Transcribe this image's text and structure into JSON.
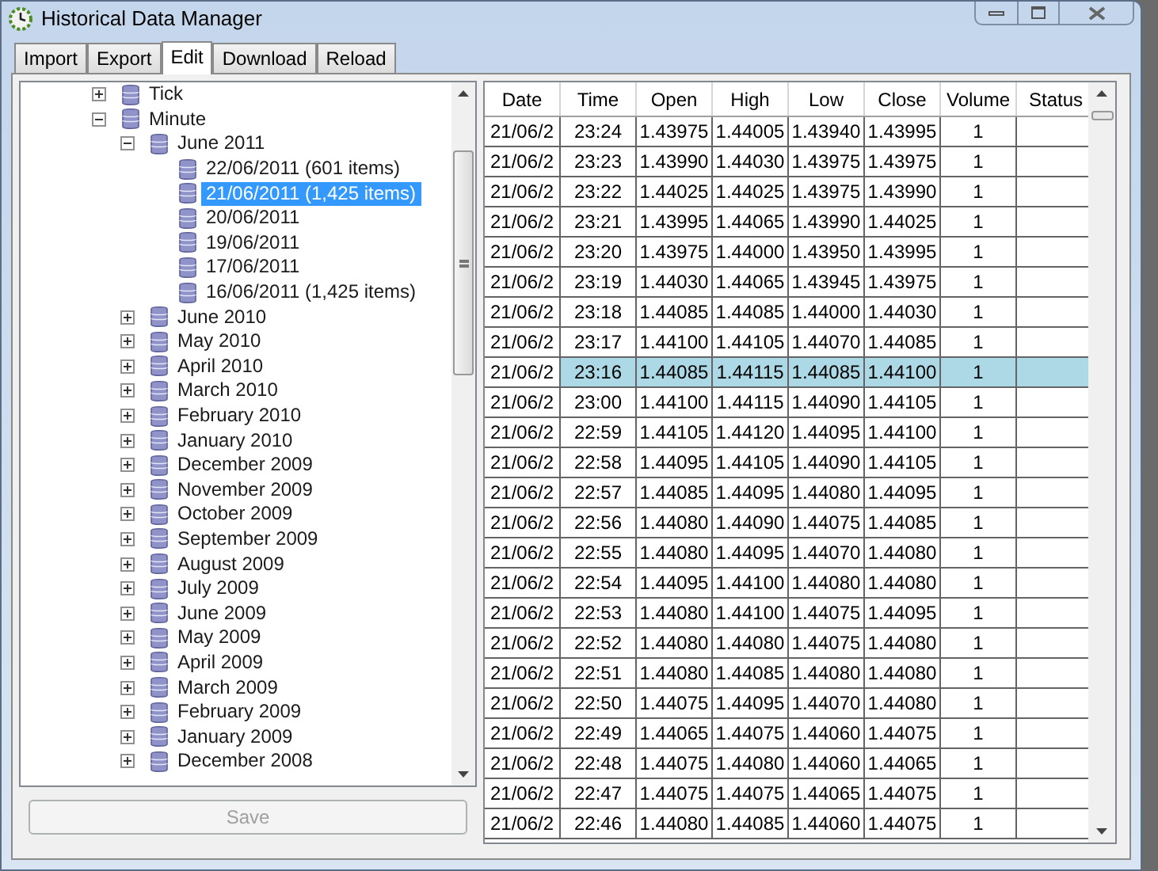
{
  "window": {
    "title": "Historical Data Manager"
  },
  "tabs": [
    {
      "label": "Import",
      "selected": false
    },
    {
      "label": "Export",
      "selected": false
    },
    {
      "label": "Edit",
      "selected": true
    },
    {
      "label": "Download",
      "selected": false
    },
    {
      "label": "Reload",
      "selected": false
    }
  ],
  "tree": [
    {
      "label": "Tick",
      "expanded": false,
      "selected": false
    },
    {
      "label": "Minute",
      "expanded": true,
      "selected": false,
      "children": [
        {
          "label": "June 2011",
          "expanded": true,
          "selected": false,
          "children": [
            {
              "label": "22/06/2011 (601 items)",
              "selected": false
            },
            {
              "label": "21/06/2011 (1,425 items)",
              "selected": true
            },
            {
              "label": "20/06/2011",
              "selected": false
            },
            {
              "label": "19/06/2011",
              "selected": false
            },
            {
              "label": "17/06/2011",
              "selected": false
            },
            {
              "label": "16/06/2011 (1,425 items)",
              "selected": false
            }
          ]
        },
        {
          "label": "June 2010",
          "expanded": false,
          "selected": false
        },
        {
          "label": "May 2010",
          "expanded": false,
          "selected": false
        },
        {
          "label": "April 2010",
          "expanded": false,
          "selected": false
        },
        {
          "label": "March 2010",
          "expanded": false,
          "selected": false
        },
        {
          "label": "February 2010",
          "expanded": false,
          "selected": false
        },
        {
          "label": "January 2010",
          "expanded": false,
          "selected": false
        },
        {
          "label": "December 2009",
          "expanded": false,
          "selected": false
        },
        {
          "label": "November 2009",
          "expanded": false,
          "selected": false
        },
        {
          "label": "October 2009",
          "expanded": false,
          "selected": false
        },
        {
          "label": "September 2009",
          "expanded": false,
          "selected": false
        },
        {
          "label": "August 2009",
          "expanded": false,
          "selected": false
        },
        {
          "label": "July 2009",
          "expanded": false,
          "selected": false
        },
        {
          "label": "June 2009",
          "expanded": false,
          "selected": false
        },
        {
          "label": "May 2009",
          "expanded": false,
          "selected": false
        },
        {
          "label": "April 2009",
          "expanded": false,
          "selected": false
        },
        {
          "label": "March 2009",
          "expanded": false,
          "selected": false
        },
        {
          "label": "February 2009",
          "expanded": false,
          "selected": false
        },
        {
          "label": "January 2009",
          "expanded": false,
          "selected": false
        },
        {
          "label": "December 2008",
          "expanded": false,
          "selected": false
        }
      ]
    }
  ],
  "save_button": {
    "label": "Save",
    "disabled": true
  },
  "table": {
    "columns": [
      "Date",
      "Time",
      "Open",
      "High",
      "Low",
      "Close",
      "Volume",
      "Status"
    ],
    "rows": [
      {
        "cells": [
          "21/06/2",
          "23:24",
          "1.43975",
          "1.44005",
          "1.43940",
          "1.43995",
          "1"
        ],
        "selected": false
      },
      {
        "cells": [
          "21/06/2",
          "23:23",
          "1.43990",
          "1.44030",
          "1.43975",
          "1.43975",
          "1"
        ],
        "selected": false
      },
      {
        "cells": [
          "21/06/2",
          "23:22",
          "1.44025",
          "1.44025",
          "1.43975",
          "1.43990",
          "1"
        ],
        "selected": false
      },
      {
        "cells": [
          "21/06/2",
          "23:21",
          "1.43995",
          "1.44065",
          "1.43990",
          "1.44025",
          "1"
        ],
        "selected": false
      },
      {
        "cells": [
          "21/06/2",
          "23:20",
          "1.43975",
          "1.44000",
          "1.43950",
          "1.43995",
          "1"
        ],
        "selected": false
      },
      {
        "cells": [
          "21/06/2",
          "23:19",
          "1.44030",
          "1.44065",
          "1.43945",
          "1.43975",
          "1"
        ],
        "selected": false
      },
      {
        "cells": [
          "21/06/2",
          "23:18",
          "1.44085",
          "1.44085",
          "1.44000",
          "1.44030",
          "1"
        ],
        "selected": false
      },
      {
        "cells": [
          "21/06/2",
          "23:17",
          "1.44100",
          "1.44105",
          "1.44070",
          "1.44085",
          "1"
        ],
        "selected": false
      },
      {
        "cells": [
          "21/06/2",
          "23:16",
          "1.44085",
          "1.44115",
          "1.44085",
          "1.44100",
          "1"
        ],
        "selected": true
      },
      {
        "cells": [
          "21/06/2",
          "23:00",
          "1.44100",
          "1.44115",
          "1.44090",
          "1.44105",
          "1"
        ],
        "selected": false
      },
      {
        "cells": [
          "21/06/2",
          "22:59",
          "1.44105",
          "1.44120",
          "1.44095",
          "1.44100",
          "1"
        ],
        "selected": false
      },
      {
        "cells": [
          "21/06/2",
          "22:58",
          "1.44095",
          "1.44105",
          "1.44090",
          "1.44105",
          "1"
        ],
        "selected": false
      },
      {
        "cells": [
          "21/06/2",
          "22:57",
          "1.44085",
          "1.44095",
          "1.44080",
          "1.44095",
          "1"
        ],
        "selected": false
      },
      {
        "cells": [
          "21/06/2",
          "22:56",
          "1.44080",
          "1.44090",
          "1.44075",
          "1.44085",
          "1"
        ],
        "selected": false
      },
      {
        "cells": [
          "21/06/2",
          "22:55",
          "1.44080",
          "1.44095",
          "1.44070",
          "1.44080",
          "1"
        ],
        "selected": false
      },
      {
        "cells": [
          "21/06/2",
          "22:54",
          "1.44095",
          "1.44100",
          "1.44080",
          "1.44080",
          "1"
        ],
        "selected": false
      },
      {
        "cells": [
          "21/06/2",
          "22:53",
          "1.44080",
          "1.44100",
          "1.44075",
          "1.44095",
          "1"
        ],
        "selected": false
      },
      {
        "cells": [
          "21/06/2",
          "22:52",
          "1.44080",
          "1.44080",
          "1.44075",
          "1.44080",
          "1"
        ],
        "selected": false
      },
      {
        "cells": [
          "21/06/2",
          "22:51",
          "1.44080",
          "1.44085",
          "1.44080",
          "1.44080",
          "1"
        ],
        "selected": false
      },
      {
        "cells": [
          "21/06/2",
          "22:50",
          "1.44075",
          "1.44095",
          "1.44070",
          "1.44080",
          "1"
        ],
        "selected": false
      },
      {
        "cells": [
          "21/06/2",
          "22:49",
          "1.44065",
          "1.44075",
          "1.44060",
          "1.44075",
          "1"
        ],
        "selected": false
      },
      {
        "cells": [
          "21/06/2",
          "22:48",
          "1.44075",
          "1.44080",
          "1.44060",
          "1.44065",
          "1"
        ],
        "selected": false
      },
      {
        "cells": [
          "21/06/2",
          "22:47",
          "1.44075",
          "1.44075",
          "1.44065",
          "1.44075",
          "1"
        ],
        "selected": false
      },
      {
        "cells": [
          "21/06/2",
          "22:46",
          "1.44080",
          "1.44085",
          "1.44060",
          "1.44075",
          "1"
        ],
        "selected": false
      }
    ]
  }
}
